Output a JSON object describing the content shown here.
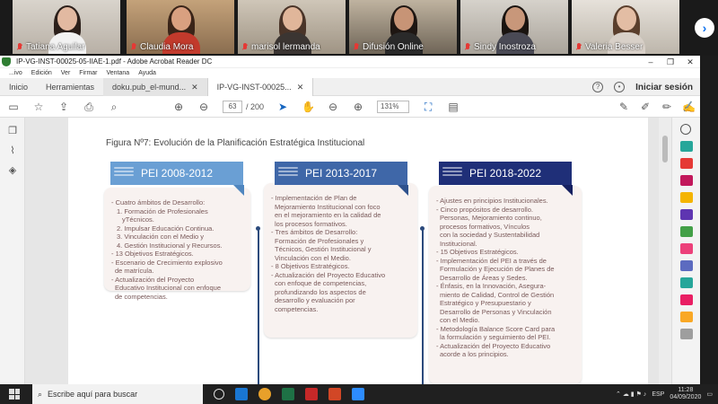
{
  "participants": [
    {
      "name": "Tatiana Aguilar"
    },
    {
      "name": "Claudia Mora"
    },
    {
      "name": "marisol lermanda"
    },
    {
      "name": "Difusión Online"
    },
    {
      "name": "Sindy Inostroza"
    },
    {
      "name": "Valeria Besser"
    }
  ],
  "window": {
    "title": "IP-VG-INST-00025-05-IIAE-1.pdf - Adobe Acrobat Reader DC",
    "menu": [
      "...ivo",
      "Edición",
      "Ver",
      "Firmar",
      "Ventana",
      "Ayuda"
    ]
  },
  "tabs": {
    "home": "Inicio",
    "tools": "Herramientas",
    "docs": [
      "doku.pub_el-mund...",
      "IP-VG-INST-00025..."
    ],
    "signin": "Iniciar sesión"
  },
  "toolbar": {
    "page_current": "63",
    "page_total": "/ 200",
    "zoom": "131%"
  },
  "document": {
    "figure_title": "Figura Nº7: Evolución de la Planificación Estratégica Institucional",
    "cards": [
      {
        "header": "PEI 2008-2012",
        "color": "#6a9fd4",
        "lines": [
          "- Cuatro ámbitos de Desarrollo:",
          "1. Formación de Profesionales",
          "yTécnicos.",
          "2. Impulsar Educación Continua.",
          "3. Vinculación con el Medio y",
          "4. Gestión Institucional y Recursos.",
          "- 13 Objetivos Estratégicos.",
          "- Escenario de Crecimiento explosivo",
          "de matrícula.",
          "- Actualización del Proyecto",
          "Educativo Institucional con enfoque",
          "de competencias."
        ]
      },
      {
        "header": "PEI 2013-2017",
        "color": "#3f67a8",
        "lines": [
          "- Implementación de Plan de",
          "Mejoramiento Institucional con foco",
          "en el mejoramiento en la calidad de",
          "los procesos formativos.",
          "- Tres ámbitos de Desarrollo:",
          "Formación de Profesionales y",
          "Técnicos, Gestión Institucional y",
          "Vinculación con el Medio.",
          "- 8 Objetivos Estratégicos.",
          "- Actualización del Proyecto Educativo",
          "con enfoque de competencias,",
          "profundizando los aspectos de",
          "desarrollo y evaluación por",
          "competencias."
        ]
      },
      {
        "header": "PEI 2018-2022",
        "color": "#1f2f78",
        "lines": [
          "- Ajustes en principios Institucionales.",
          "- Cinco propósitos de desarrollo.",
          "Personas, Mejoramiento continuo,",
          "procesos formativos, Vínculos",
          "con la sociedad y Sustentabilidad",
          "Institucional.",
          "- 15 Objetivos Estratégicos.",
          "- Implementación del PEI a través de",
          "Formulación y Ejecución de Planes de",
          "Desarrollo de Áreas y Sedes.",
          "- Énfasis, en la Innovación, Asegura-",
          "miento de Calidad, Control de Gestión",
          "Estratégico y Presupuestario y",
          "Desarrollo de Personas y Vinculación",
          "con el Medio.",
          "- Metodología Balance Score Card para",
          "la formulación y seguimiento del PEI.",
          "- Actualización del Proyecto Educativo",
          "acorde a los principios."
        ]
      }
    ]
  },
  "taskbar": {
    "search_placeholder": "Escribe aquí para buscar",
    "lang": "ESP",
    "time": "11:28",
    "date": "04/09/2020"
  }
}
